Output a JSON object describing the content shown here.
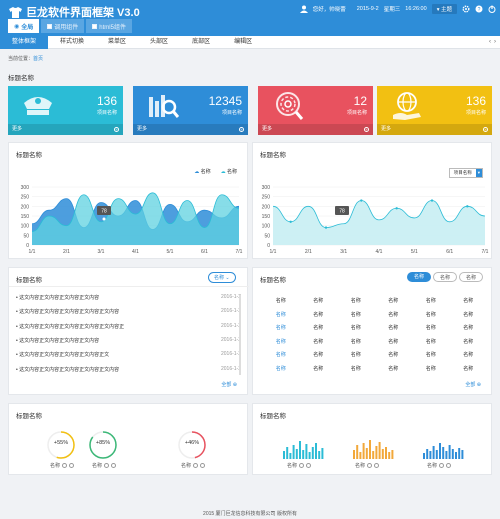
{
  "header": {
    "title": "巨龙软件界面框架 V3.0",
    "greeting": "您好，帅晓蕾",
    "date": "2015-9-2",
    "weekday": "星期三",
    "time": "16:26:00",
    "theme": "主题",
    "tabs": [
      {
        "label": "全局"
      },
      {
        "label": "调用组件"
      },
      {
        "label": "html5组件"
      }
    ]
  },
  "nav": {
    "items": [
      "整体框架",
      "样式切换",
      "菜单区",
      "头部区",
      "底部区",
      "编辑区"
    ]
  },
  "breadcrumb": {
    "prefix": "当前位置：",
    "current": "首页"
  },
  "section_title": "标题名称",
  "tiles": [
    {
      "value": "136",
      "label": "项目名称",
      "more": "更多",
      "color": "#2bbcd6"
    },
    {
      "value": "12345",
      "label": "项目名称",
      "more": "更多",
      "color": "#2e8dd8"
    },
    {
      "value": "12",
      "label": "项目名称",
      "more": "更多",
      "color": "#e8525f"
    },
    {
      "value": "136",
      "label": "项目名称",
      "more": "更多",
      "color": "#f2c012"
    }
  ],
  "card1": {
    "title": "标题名称",
    "legend": [
      "名称",
      "名称"
    ]
  },
  "card2": {
    "title": "标题名称",
    "select": "项目名称"
  },
  "card3": {
    "title": "标题名称",
    "button": "名称",
    "more": "全部",
    "rows": [
      {
        "text": "这文内容正文内容正文内容正文内容",
        "date": "2016-1-2"
      },
      {
        "text": "这文内容正文内容正文内容正文内容正文内容",
        "date": "2016-1-2"
      },
      {
        "text": "这文内容正文内容正文内容正文内容正文内容正",
        "date": "2016-1-2"
      },
      {
        "text": "这文内容正文内容正文内容正文内容",
        "date": "2016-1-2"
      },
      {
        "text": "这文内容正文内容正文内容正文内容正文",
        "date": "2016-1-2"
      },
      {
        "text": "这文内容正文内容正文内容正文内容正文内容",
        "date": "2016-1-2"
      }
    ]
  },
  "card4": {
    "title": "标题名称",
    "pills": [
      "名称",
      "名称",
      "名称"
    ],
    "more": "全部",
    "header": [
      "名称",
      "名称",
      "名称",
      "名称",
      "名称",
      "名称"
    ],
    "cell": "名称",
    "rows": 6
  },
  "card5": {
    "title": "标题名称",
    "gauges": [
      {
        "value": "+55%",
        "label": "名称",
        "color": "#f2c012",
        "pct": 55
      },
      {
        "value": "+85%",
        "label": "名称",
        "color": "#3cb878",
        "pct": 85
      },
      {
        "value": "+46%",
        "label": "名称",
        "color": "#e8525f",
        "pct": 46
      }
    ]
  },
  "card6": {
    "title": "标题名称",
    "labels": [
      "名称",
      "名称",
      "名称"
    ],
    "colors": [
      "#2bbcd6",
      "#f2a83a",
      "#2e8dd8"
    ]
  },
  "chart_data": [
    {
      "type": "area",
      "categories": [
        "1/1",
        "2/1",
        "3/1",
        "4/1",
        "5/1",
        "6/1",
        "7/1"
      ],
      "ylim": [
        0,
        300
      ],
      "yticks": [
        0,
        50,
        100,
        150,
        200,
        250,
        300
      ],
      "series": [
        {
          "name": "名称",
          "values": [
            110,
            180,
            240,
            90,
            220,
            150,
            230,
            80,
            210,
            120,
            180,
            140,
            200
          ]
        },
        {
          "name": "名称",
          "values": [
            70,
            150,
            100,
            260,
            120,
            240,
            160,
            270,
            110,
            230,
            90,
            260,
            190
          ]
        }
      ],
      "annotation": "78"
    },
    {
      "type": "area",
      "categories": [
        "1/1",
        "2/1",
        "3/1",
        "4/1",
        "5/1",
        "6/1",
        "7/1"
      ],
      "ylim": [
        0,
        300
      ],
      "yticks": [
        0,
        50,
        100,
        150,
        200,
        250,
        300
      ],
      "series": [
        {
          "values": [
            200,
            120,
            200,
            90,
            110,
            230,
            130,
            190,
            140,
            230,
            120,
            200,
            150
          ]
        }
      ],
      "annotation": "78"
    }
  ],
  "footer": "2015  厦门巨龙信息科技有限公司  版权所有"
}
